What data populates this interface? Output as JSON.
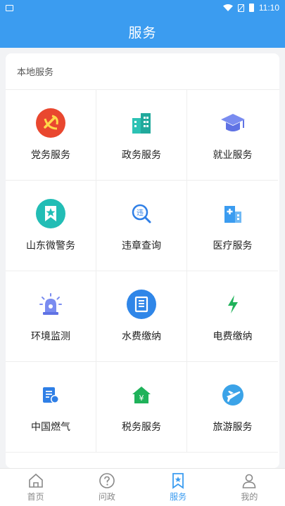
{
  "status_bar": {
    "time": "11:10"
  },
  "header": {
    "title": "服务"
  },
  "section": {
    "title": "本地服务"
  },
  "services": [
    {
      "label": "党务服务",
      "icon": "party-emblem-icon"
    },
    {
      "label": "政务服务",
      "icon": "government-building-icon"
    },
    {
      "label": "就业服务",
      "icon": "graduation-cap-icon"
    },
    {
      "label": "山东微警务",
      "icon": "police-badge-icon"
    },
    {
      "label": "违章查询",
      "icon": "violation-search-icon"
    },
    {
      "label": "医疗服务",
      "icon": "hospital-icon"
    },
    {
      "label": "环境监测",
      "icon": "siren-icon"
    },
    {
      "label": "水费缴纳",
      "icon": "water-bill-icon"
    },
    {
      "label": "电费缴纳",
      "icon": "lightning-icon"
    },
    {
      "label": "中国燃气",
      "icon": "gas-bill-icon"
    },
    {
      "label": "税务服务",
      "icon": "tax-house-icon"
    },
    {
      "label": "旅游服务",
      "icon": "travel-plane-icon"
    }
  ],
  "tabbar": [
    {
      "label": "首页",
      "icon": "home-icon",
      "active": false
    },
    {
      "label": "问政",
      "icon": "question-icon",
      "active": false
    },
    {
      "label": "服务",
      "icon": "bookmark-star-icon",
      "active": true
    },
    {
      "label": "我的",
      "icon": "user-icon",
      "active": false
    }
  ],
  "colors": {
    "primary": "#3b9cf0",
    "party_red": "#e9472f",
    "teal": "#2cc2b4",
    "purple": "#7a8cf0",
    "green": "#1fb25a"
  }
}
